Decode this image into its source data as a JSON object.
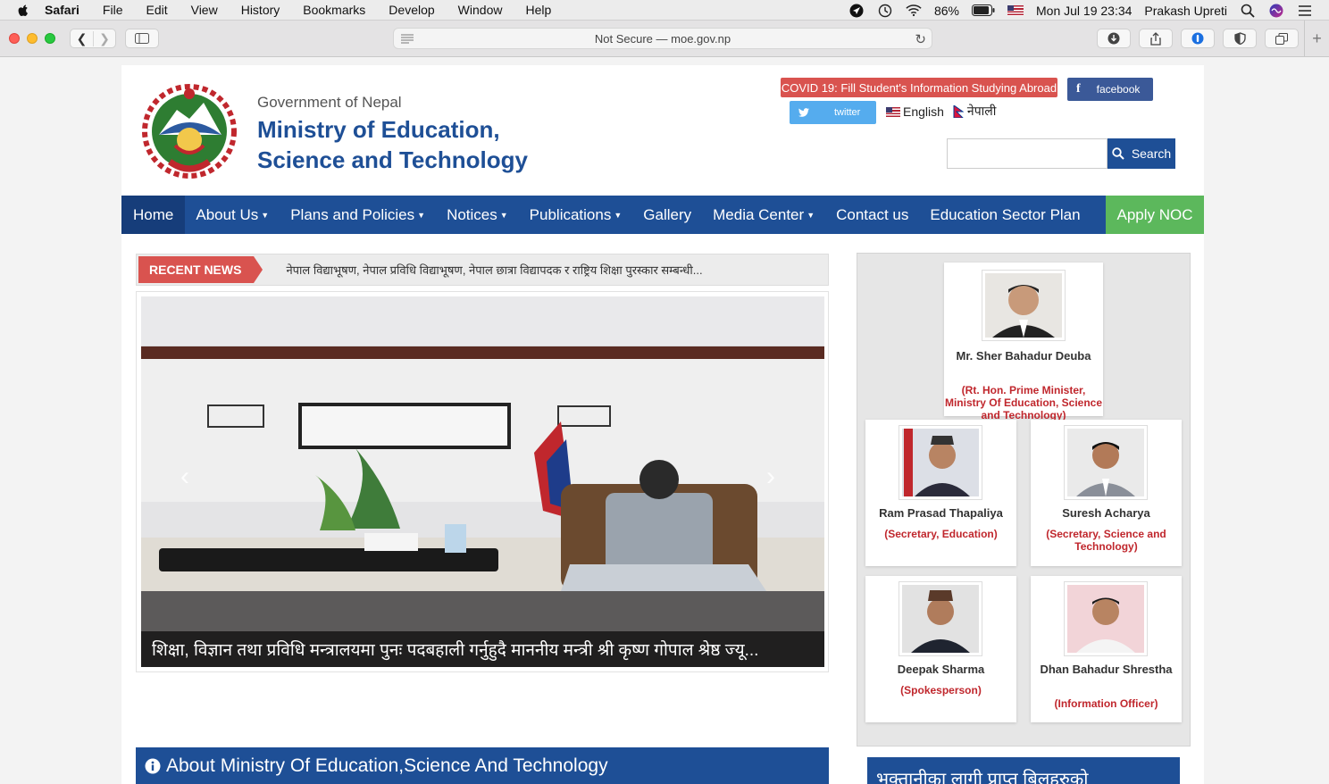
{
  "menubar": {
    "app": "Safari",
    "items": [
      "File",
      "Edit",
      "View",
      "History",
      "Bookmarks",
      "Develop",
      "Window",
      "Help"
    ],
    "battery": "86%",
    "datetime": "Mon Jul 19  23:34",
    "user": "Prakash Upreti"
  },
  "browser": {
    "address": "Not Secure — moe.gov.np"
  },
  "header": {
    "gov": "Government of Nepal",
    "title_line1": "Ministry of Education,",
    "title_line2": "Science and Technology",
    "covid": "COVID 19: Fill Student's Information Studying Abroad",
    "facebook": "facebook",
    "twitter": "twitter",
    "lang_en": "English",
    "lang_np": "नेपाली",
    "search_label": "Search"
  },
  "nav": {
    "items": [
      "Home",
      "About Us",
      "Plans and Policies",
      "Notices",
      "Publications",
      "Gallery",
      "Media Center",
      "Contact us",
      "Education Sector Plan"
    ],
    "apply": "Apply NOC"
  },
  "recent": {
    "tag": "RECENT NEWS",
    "text": "नेपाल विद्याभूषण, नेपाल प्रविधि विद्याभूषण, नेपाल छात्रा विद्यापदक र राष्ट्रिय शिक्षा पुरस्कार सम्बन्धी..."
  },
  "slider": {
    "caption": "शिक्षा, विज्ञान तथा प्रविधि मन्त्रालयमा पुनः पदबहाली गर्नुहुदै माननीय मन्त्री श्री कृष्ण गोपाल श्रेष्ठ ज्यू..."
  },
  "about": {
    "title": "About Ministry Of Education,Science And Technology"
  },
  "officials": [
    {
      "name": "Mr. Sher Bahadur Deuba",
      "role": "(Rt. Hon. Prime Minister, Ministry Of Education, Science and Technology)"
    },
    {
      "name": "Ram Prasad Thapaliya",
      "role": "(Secretary, Education)"
    },
    {
      "name": "Suresh Acharya",
      "role": "(Secretary, Science and Technology)"
    },
    {
      "name": "Deepak Sharma",
      "role": "(Spokesperson)"
    },
    {
      "name": "Dhan Bahadur Shrestha",
      "role": "(Information Officer)"
    }
  ],
  "sidebar_bottom": "भक्तानीका लागी प्राप्त बिलहरुको",
  "colors": {
    "brand_blue": "#1e4f96",
    "accent_red": "#d9534f",
    "apply_green": "#5cb85c",
    "role_red": "#c0272d"
  }
}
